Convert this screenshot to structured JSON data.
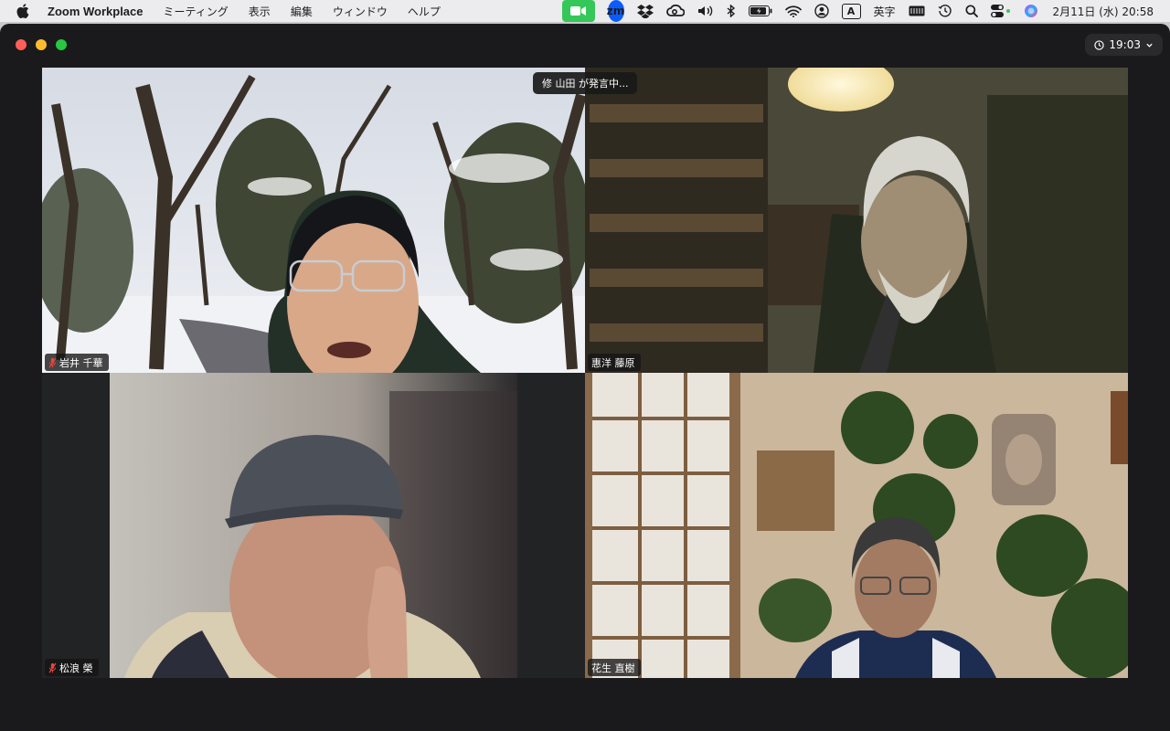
{
  "menubar": {
    "app_name": "Zoom Workplace",
    "menus": [
      "ミーティング",
      "表示",
      "編集",
      "ウィンドウ",
      "ヘルプ"
    ],
    "ime_badge": "A",
    "ime_label": "英字",
    "datetime": "2月11日 (水)  20:58"
  },
  "window": {
    "timer": "19:03",
    "speaker_banner": "修 山田 が発言中..."
  },
  "participants": [
    {
      "name": "岩井 千華",
      "muted": true
    },
    {
      "name": "惠洋 藤原",
      "muted": false
    },
    {
      "name": "松浪 榮",
      "muted": true
    },
    {
      "name": "花生 直樹",
      "muted": false
    }
  ],
  "colors": {
    "menubar_bg": "#ececee",
    "window_bg": "#1a1a1c",
    "zoom_green": "#35c759",
    "zoom_blue": "#0b5cff",
    "muted_red": "#e8453c"
  }
}
